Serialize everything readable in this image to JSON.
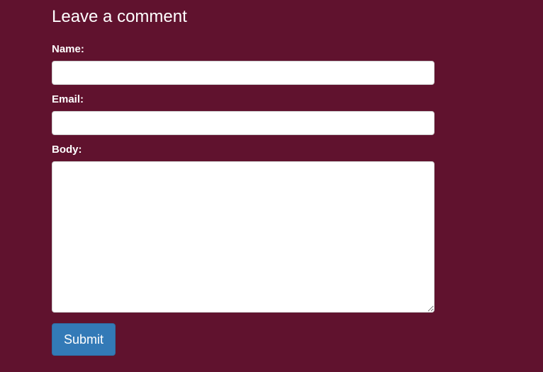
{
  "form": {
    "title": "Leave a comment",
    "name_label": "Name:",
    "name_value": "",
    "email_label": "Email:",
    "email_value": "",
    "body_label": "Body:",
    "body_value": "",
    "submit_label": "Submit"
  },
  "colors": {
    "background": "#60122e",
    "submit_button": "#337ab7",
    "input_background": "#ffffff"
  }
}
